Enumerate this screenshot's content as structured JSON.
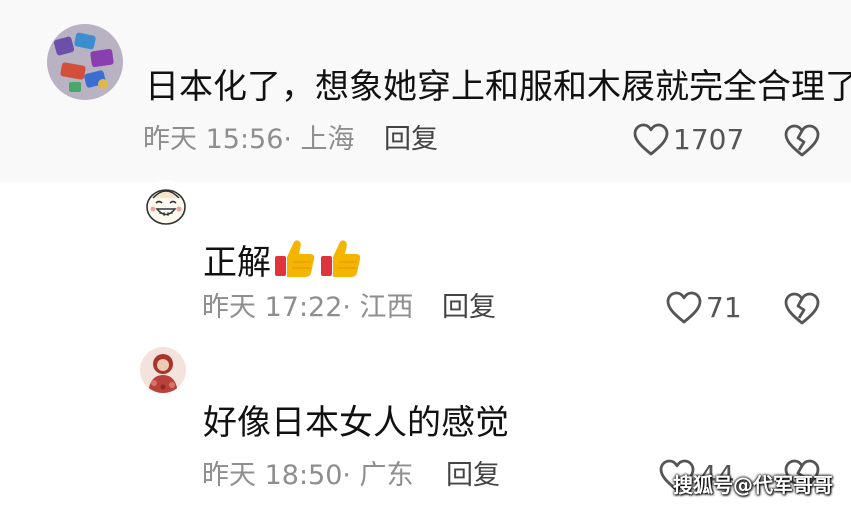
{
  "comments": [
    {
      "text": "日本化了，想象她穿上和服和木屐就完全合理了",
      "meta": "昨天 15:56· 上海",
      "reply_label": "回复",
      "likes": "1707"
    },
    {
      "text": "正解",
      "meta": "昨天 17:22· 江西",
      "reply_label": "回复",
      "likes": "71"
    },
    {
      "text": "好像日本女人的感觉",
      "meta": "昨天 18:50· 广东",
      "reply_label": "回复",
      "likes": "44"
    }
  ],
  "watermark": "搜狐号@代军哥哥",
  "colors": {
    "meta_gray": "#8e8e8e",
    "text_dark": "#111111",
    "top_band_bg": "#f9f9f9",
    "thumbs_up_yellow": "#f5b400",
    "thumbs_up_red": "#e0343c"
  },
  "icons": [
    "heart-outline-icon",
    "broken-heart-icon",
    "thumbs-up-emoji"
  ]
}
